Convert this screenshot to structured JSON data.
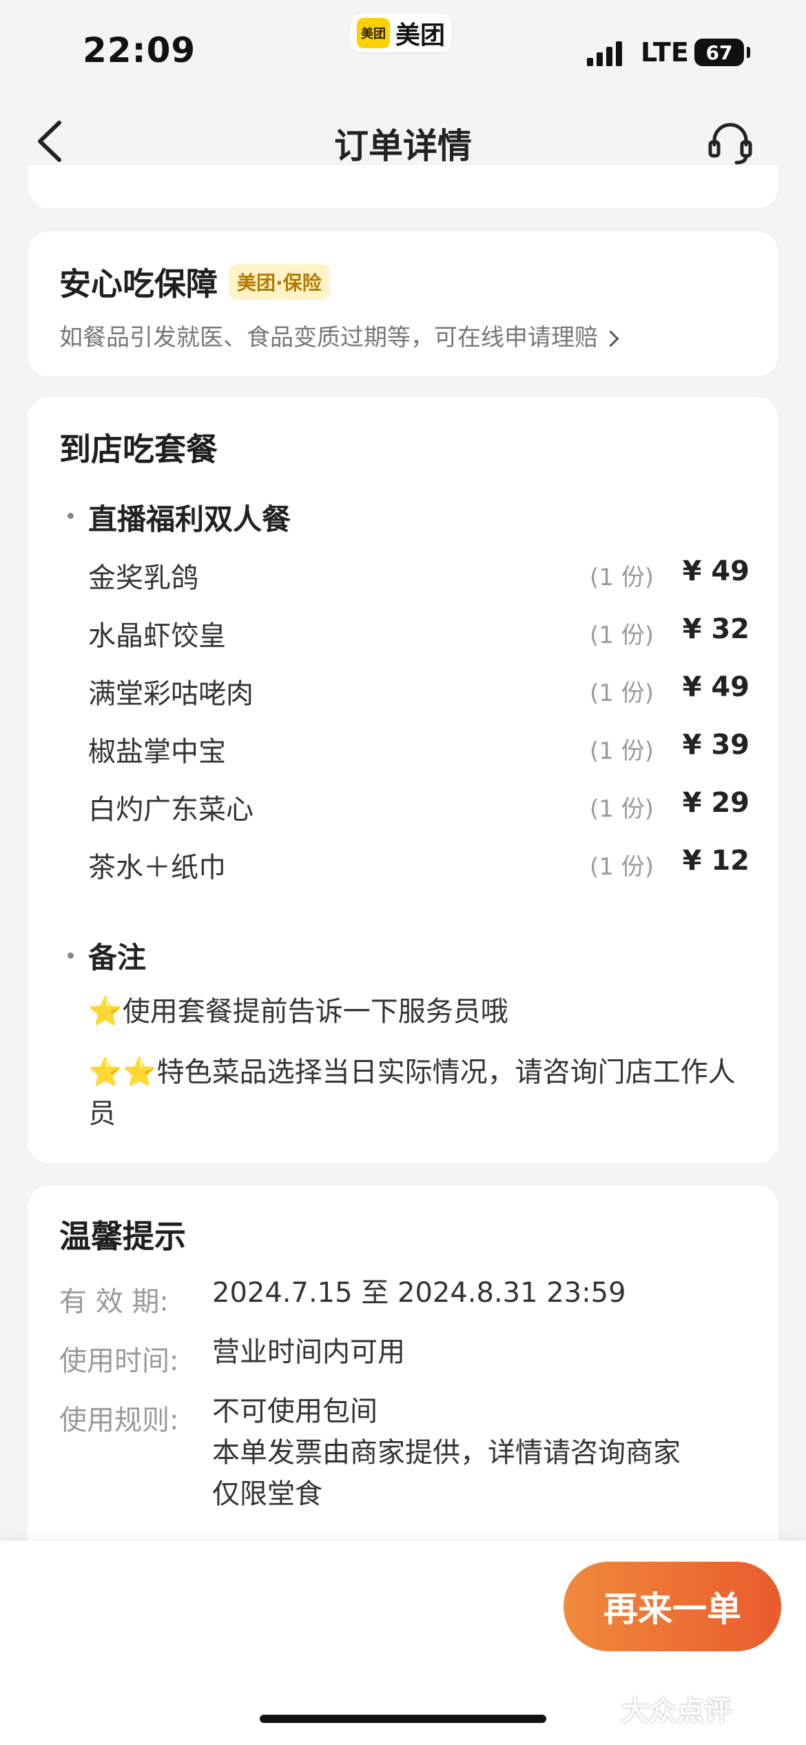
{
  "status_bar": {
    "time": "22:09",
    "app_badge": "美团",
    "app_name": "美团",
    "carrier": "LTE",
    "battery": "67"
  },
  "nav": {
    "title": "订单详情"
  },
  "guarantee": {
    "title": "安心吃保障",
    "badge": "美团·保险",
    "description": "如餐品引发就医、食品变质过期等，可在线申请理赔"
  },
  "package": {
    "section_title": "到店吃套餐",
    "package_name": "直播福利双人餐",
    "items": [
      {
        "name": "金奖乳鸽",
        "qty": "(1 份)",
        "price": "¥ 49"
      },
      {
        "name": "水晶虾饺皇",
        "qty": "(1 份)",
        "price": "¥ 32"
      },
      {
        "name": "满堂彩咕咾肉",
        "qty": "(1 份)",
        "price": "¥ 49"
      },
      {
        "name": "椒盐掌中宝",
        "qty": "(1 份)",
        "price": "¥ 39"
      },
      {
        "name": "白灼广东菜心",
        "qty": "(1 份)",
        "price": "¥ 29"
      },
      {
        "name": "茶水＋纸巾",
        "qty": "(1 份)",
        "price": "¥ 12"
      }
    ],
    "notes_title": "备注",
    "notes": [
      {
        "icon": "⭐",
        "text": "使用套餐提前告诉一下服务员哦"
      },
      {
        "icon": "⭐⭐",
        "text": "特色菜品选择当日实际情况，请咨询门店工作人员"
      }
    ]
  },
  "tips": {
    "title": "温馨提示",
    "validity_label": "有 效 期:",
    "validity_value": "2024.7.15 至 2024.8.31 23:59",
    "usage_time_label": "使用时间:",
    "usage_time_value": "营业时间内可用",
    "rules_label": "使用规则:",
    "rules": [
      "不可使用包间",
      "本单发票由商家提供，详情请咨询商家",
      "仅限堂食"
    ]
  },
  "bottom": {
    "reorder_label": "再来一单",
    "watermark": "大众点评"
  },
  "colors": {
    "accent_start": "#f08a3c",
    "accent_end": "#ea5b2d",
    "badge_bg": "#fff3c7",
    "brand_yellow": "#ffd100"
  }
}
